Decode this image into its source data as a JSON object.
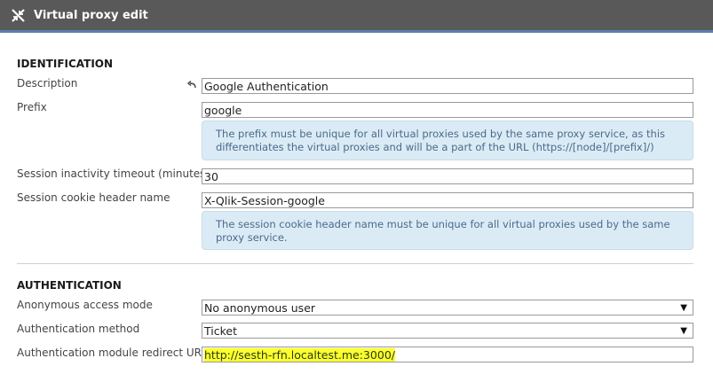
{
  "window": {
    "title": "Virtual proxy edit",
    "icon": "collapse-arrows-icon"
  },
  "identification": {
    "heading": "IDENTIFICATION",
    "description_label": "Description",
    "description_value": "Google Authentication",
    "undo_icon": "undo-arrow-icon",
    "prefix_label": "Prefix",
    "prefix_value": "google",
    "prefix_info_line1": "The prefix must be unique for all virtual proxies used by the same proxy service, as this",
    "prefix_info_line2": "differentiates the virtual proxies and will be a part of the URL (https://[node]/[prefix]/)",
    "timeout_label": "Session inactivity timeout (minutes)",
    "timeout_value": "30",
    "cookie_label": "Session cookie header name",
    "cookie_value": "X-Qlik-Session-google",
    "cookie_info_line1": "The session cookie header name must be unique for all virtual proxies used by the same",
    "cookie_info_line2": "proxy service."
  },
  "authentication": {
    "heading": "AUTHENTICATION",
    "anon_label": "Anonymous access mode",
    "anon_value": "No anonymous user",
    "method_label": "Authentication method",
    "method_value": "Ticket",
    "redirect_label": "Authentication module redirect URI",
    "redirect_value": "http://sesth-rfn.localtest.me:3000/"
  },
  "colors": {
    "titlebar": "#595959",
    "accent": "#5b7fb0",
    "info_background": "#dbebf6",
    "highlight": "#fcff2b"
  }
}
